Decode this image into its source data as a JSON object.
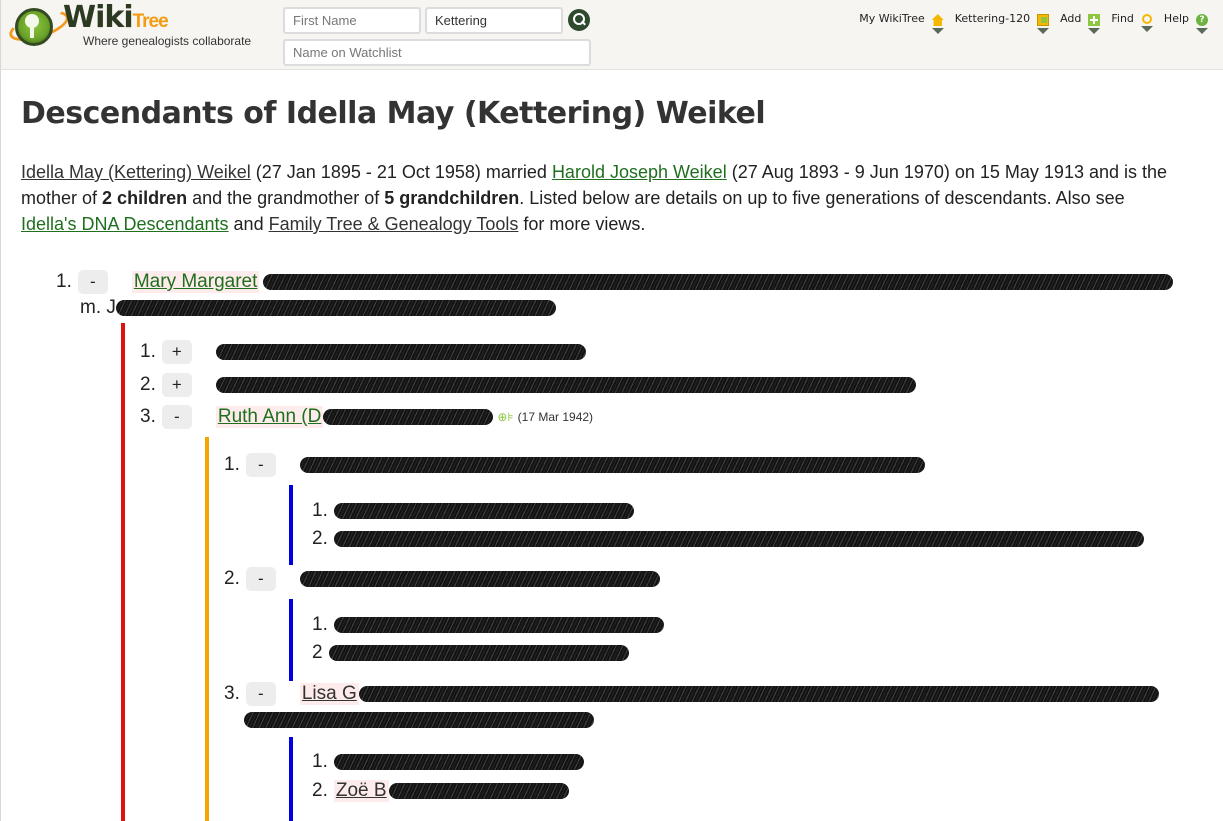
{
  "header": {
    "logo_text_1": "Wiki",
    "logo_text_2": "Tree",
    "tagline": "Where genealogists collaborate",
    "search": {
      "first_name_placeholder": "First Name",
      "last_name_value": "Kettering",
      "watchlist_placeholder": "Name on Watchlist",
      "search_icon": "magnifier-icon"
    },
    "nav": [
      {
        "label": "My WikiTree",
        "icon": "home-icon"
      },
      {
        "label": "Kettering-120",
        "icon": "profile-icon"
      },
      {
        "label": "Add",
        "icon": "plus-icon"
      },
      {
        "label": "Find",
        "icon": "magnifier-icon"
      },
      {
        "label": "Help",
        "icon": "help-icon",
        "glyph": "?"
      }
    ]
  },
  "page": {
    "title": "Descendants of Idella May (Kettering) Weikel",
    "intro": {
      "subject_link": "Idella May (Kettering) Weikel",
      "subject_dates": " (27 Jan 1895 - 21 Oct 1958) married ",
      "spouse_link": "Harold Joseph Weikel",
      "spouse_dates": " (27 Aug 1893 - 9 Jun 1970) on 15 May 1913 and is the mother of ",
      "children_count": "2 children",
      "mid_text": " and the grandmother of ",
      "grandchildren_count": "5 grandchildren",
      "tail_text": ". Listed below are details on up to five generations of descendants. Also see ",
      "dna_link": "Idella's DNA Descendants",
      "and_text": " and ",
      "tools_link": "Family Tree & Genealogy Tools",
      "end_text": " for more views."
    }
  },
  "tree": {
    "gen1": [
      {
        "num": "1.",
        "toggle": "-",
        "name_visible": "Mary Margaret",
        "spouse_prefix": "m. J"
      }
    ],
    "gen2": [
      {
        "num": "1.",
        "toggle": "+"
      },
      {
        "num": "2.",
        "toggle": "+"
      },
      {
        "num": "3.",
        "toggle": "-",
        "name_visible": "Ruth Ann (D",
        "date": "(17 Mar 1942)"
      }
    ],
    "gen3": [
      {
        "num": "1.",
        "toggle": "-",
        "children": [
          {
            "num": "1."
          },
          {
            "num": "2."
          }
        ]
      },
      {
        "num": "2.",
        "toggle": "-",
        "children": [
          {
            "num": "1."
          },
          {
            "num": "2"
          }
        ]
      },
      {
        "num": "3.",
        "toggle": "-",
        "name_visible": "Lisa G",
        "children": [
          {
            "num": "1."
          },
          {
            "num": "2.",
            "name_visible": "Zoë B"
          }
        ]
      }
    ],
    "redacted_note": "Descendant names and details are scribbled out"
  },
  "colors": {
    "gen_bar_1": "#e01010",
    "gen_bar_2": "#f5a400",
    "gen_bar_3": "#0000e0",
    "link_green": "#1f6f1f",
    "female_bg": "#fdeceb",
    "male_bg": "#eef0fd"
  }
}
